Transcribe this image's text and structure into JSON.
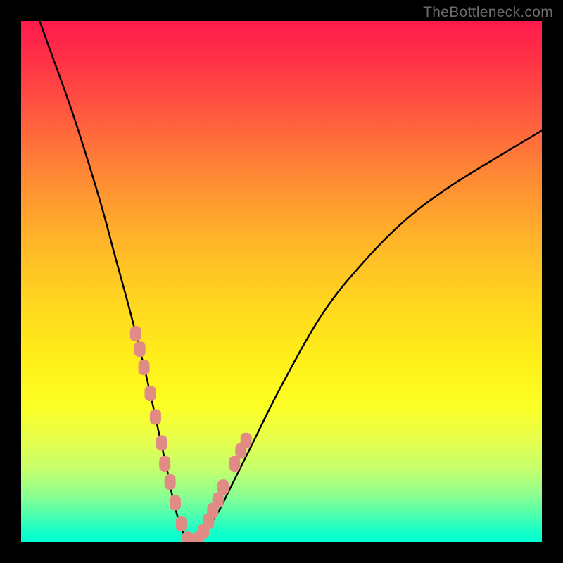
{
  "watermark_text": "TheBottleneck.com",
  "chart_data": {
    "type": "line",
    "title": "",
    "xlabel": "",
    "ylabel": "",
    "xlim": [
      0,
      100
    ],
    "ylim": [
      0,
      100
    ],
    "legend": false,
    "grid": false,
    "background": "rainbow-vertical-gradient",
    "series": [
      {
        "name": "bottleneck-curve",
        "x": [
          0,
          5,
          10,
          15,
          18,
          21,
          24,
          26,
          28,
          29,
          30,
          31,
          32,
          33,
          34,
          36,
          38,
          40,
          44,
          50,
          58,
          66,
          74,
          82,
          90,
          100
        ],
        "values": [
          110,
          96,
          82,
          66,
          55,
          44,
          32,
          23,
          14,
          9,
          5,
          2,
          0,
          0,
          1,
          3,
          6,
          10,
          18,
          30,
          44,
          54,
          62,
          68,
          73,
          79
        ]
      },
      {
        "name": "bead-markers",
        "type": "scatter",
        "x": [
          22.0,
          22.8,
          23.6,
          24.8,
          25.8,
          27.0,
          27.6,
          28.6,
          29.6,
          30.8,
          32.0,
          33.0,
          34.0,
          35.0,
          36.0,
          36.8,
          37.8,
          38.8,
          41.0,
          42.2,
          43.2
        ],
        "values": [
          40.0,
          37.0,
          33.5,
          28.5,
          24.0,
          19.0,
          15.0,
          11.5,
          7.5,
          3.5,
          0.5,
          0.0,
          0.5,
          2.0,
          4.0,
          6.0,
          8.0,
          10.5,
          15.0,
          17.5,
          19.5
        ]
      }
    ],
    "colors": {
      "curve": "#000000",
      "markers": "#e08b84"
    }
  }
}
